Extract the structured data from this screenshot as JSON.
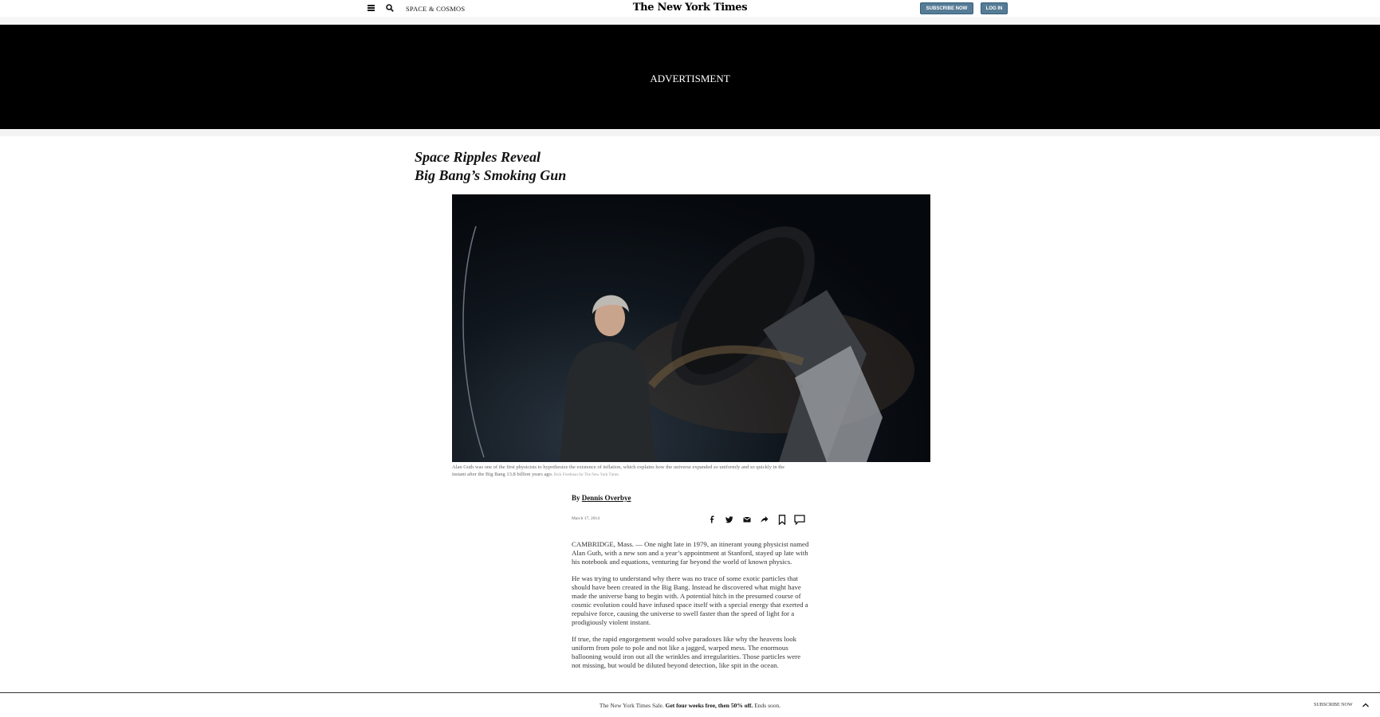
{
  "header": {
    "section": "SPACE & COSMOS",
    "logo": "The New York Times",
    "subscribe_label": "SUBSCRIBE NOW",
    "login_label": "LOG IN"
  },
  "ad": {
    "label": "ADVERTISMENT"
  },
  "article": {
    "headline_line1": "Space Ripples Reveal",
    "headline_line2": "Big Bang’s Smoking Gun",
    "caption": "Alan Guth was one of the first physicists to hypothesize the existence of inflation, which explains how the universe expanded so uniformly and so quickly in the instant after the Big Bang 13.8 billion years ago.",
    "photo_credit": "Rick Friedman for The New York Times",
    "byline_prefix": "By",
    "author": "Dennis Overbye",
    "date": "March 17, 2014",
    "paragraphs": [
      "CAMBRIDGE, Mass. — One night late in 1979, an itinerant young physicist named Alan Guth, with a new son and a year’s appointment at Stanford, stayed up late with his notebook and equations, venturing far beyond the world of known physics.",
      "He was trying to understand why there was no trace of some exotic particles that should have been created in the Big Bang. Instead he discovered what might have made the universe bang to begin with. A potential hitch in the presumed course of cosmic evolution could have infused space itself with a special energy that exerted a repulsive force, causing the universe to swell faster than the speed of light for a prodigiously violent instant.",
      "If true, the rapid engorgement would solve paradoxes like why the heavens look uniform from pole to pole and not like a jagged, warped mess. The enormous ballooning would iron out all the wrinkles and irregularities. Those particles were not missing, but would be diluted beyond detection, like spit in the ocean."
    ]
  },
  "share_icons": [
    "facebook-icon",
    "twitter-icon",
    "email-icon",
    "share-icon",
    "bookmark-icon",
    "comment-icon"
  ],
  "footer": {
    "promo_prefix": "The New York Times Sale.",
    "promo_bold": "Get four weeks free, then 50% off.",
    "promo_suffix": "Ends soon.",
    "subscribe_label": "SUBSCRIBE NOW"
  },
  "colors": {
    "button": "#567b95",
    "ad_background": "#000000"
  }
}
